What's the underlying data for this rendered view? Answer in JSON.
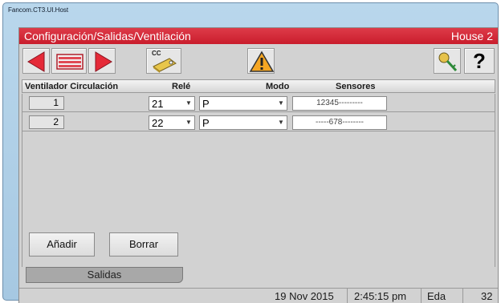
{
  "window": {
    "title": "Fancom.CT3.UI.Host"
  },
  "header": {
    "path": "Configuración/Salidas/Ventilación",
    "house": "House 2",
    "bg_color": "#d32737"
  },
  "toolbar": {
    "cc_label": "CC",
    "help_label": "?"
  },
  "columns": {
    "ventilador": "Ventilador Circulación",
    "rele": "Relé",
    "modo": "Modo",
    "sensores": "Sensores"
  },
  "rows": [
    {
      "num": "1",
      "rele": "21",
      "modo": "P",
      "sensores": "12345---------"
    },
    {
      "num": "2",
      "rele": "22",
      "modo": "P",
      "sensores": "-----678--------"
    }
  ],
  "buttons": {
    "add": "Añadir",
    "delete": "Borrar"
  },
  "tab": {
    "label": "Salidas"
  },
  "status": {
    "date": "19 Nov 2015",
    "time": "2:45:15 pm",
    "lang": "Eda",
    "num": "32"
  }
}
